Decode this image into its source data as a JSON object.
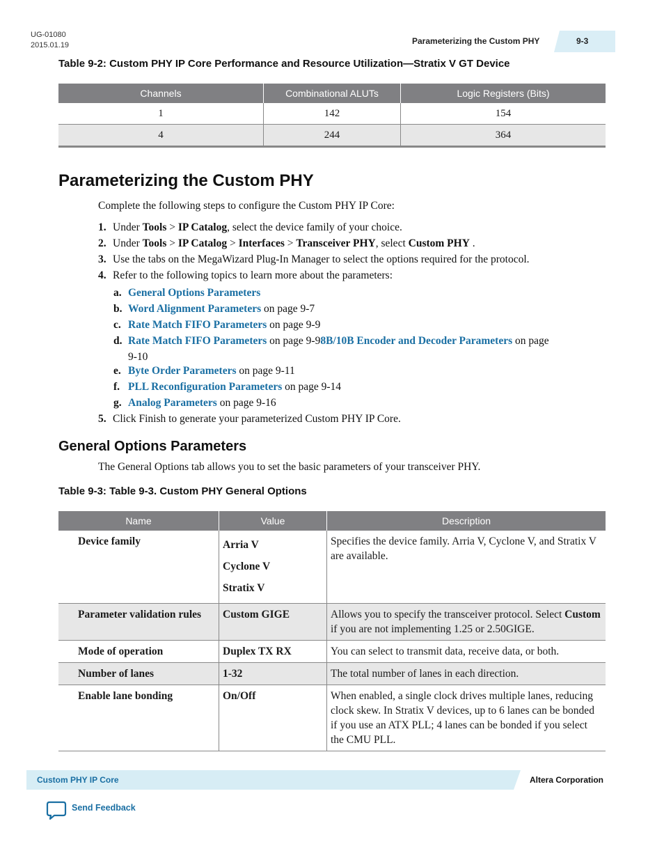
{
  "header": {
    "doc_id": "UG-01080",
    "doc_date": "2015.01.19",
    "section_title": "Parameterizing the Custom PHY",
    "page_number": "9-3"
  },
  "table_9_2": {
    "caption": "Table 9-2: Custom PHY IP Core Performance and Resource Utilization—Stratix V GT Device",
    "columns": [
      "Channels",
      "Combinational ALUTs",
      "Logic Registers (Bits)"
    ],
    "rows": [
      [
        "1",
        "142",
        "154"
      ],
      [
        "4",
        "244",
        "364"
      ]
    ]
  },
  "section": {
    "title": "Parameterizing the Custom PHY",
    "intro": "Complete the following steps to configure the Custom PHY IP Core:",
    "steps": [
      {
        "num": "1.",
        "parts": [
          "Under ",
          "Tools",
          " > ",
          "IP Catalog",
          ", select the device family of your choice."
        ]
      },
      {
        "num": "2.",
        "parts": [
          "Under ",
          "Tools",
          " > ",
          "IP Catalog",
          " > ",
          "Interfaces",
          " > ",
          "Transceiver PHY",
          ", select ",
          "Custom PHY",
          " ."
        ]
      },
      {
        "num": "3.",
        "text": "Use the tabs on the MegaWizard Plug-In Manager to select the options required for the protocol."
      },
      {
        "num": "4.",
        "text": "Refer to the following topics to learn more about the parameters:"
      },
      {
        "num": "5.",
        "text": "Click Finish to generate your parameterized Custom PHY IP Core."
      }
    ],
    "topics": [
      {
        "num": "a.",
        "link": "General Options Parameters",
        "suffix": ""
      },
      {
        "num": "b.",
        "link": "Word Alignment Parameters",
        "suffix": " on page 9-7"
      },
      {
        "num": "c.",
        "link": "Rate Match FIFO Parameters",
        "suffix": " on page 9-9"
      },
      {
        "num": "d.",
        "link": "Rate Match FIFO Parameters",
        "mid": " on page 9-9",
        "link2": "8B/10B Encoder and Decoder Parameters",
        "suffix": " on page",
        "suffix2": "9-10"
      },
      {
        "num": "e.",
        "link": "Byte Order Parameters",
        "suffix": " on page 9-11"
      },
      {
        "num": "f.",
        "link": "PLL Reconfiguration Parameters",
        "suffix": " on page 9-14"
      },
      {
        "num": "g.",
        "link": "Analog Parameters",
        "suffix": " on page 9-16"
      }
    ]
  },
  "subsection": {
    "title": "General Options Parameters",
    "intro": "The General Options tab allows you to set the basic parameters of your transceiver PHY."
  },
  "table_9_3": {
    "caption": "Table 9-3: Table 9-3.   Custom PHY General Options",
    "columns": [
      "Name",
      "Value",
      "Description"
    ],
    "rows": [
      {
        "name": "Device family",
        "values": [
          "Arria V",
          "Cyclone V",
          "Stratix V"
        ],
        "description": "Specifies the device family. Arria V, Cyclone V, and Stratix V are available."
      },
      {
        "name": "Parameter validation rules",
        "values": [
          "Custom GIGE"
        ],
        "description_parts": [
          "Allows you to specify the transceiver protocol. Select ",
          "Custom",
          " if you are not implementing 1.25 or 2.50GIGE."
        ]
      },
      {
        "name": "Mode of operation",
        "values": [
          "Duplex TX RX"
        ],
        "description": "You can select to transmit data, receive data, or both."
      },
      {
        "name": "Number of lanes",
        "values": [
          "1-32"
        ],
        "description": "The total number of lanes in each direction."
      },
      {
        "name": "Enable lane bonding",
        "values": [
          "On/Off"
        ],
        "description": "When enabled, a single clock drives multiple lanes, reducing clock skew. In Stratix V devices, up to 6 lanes can be bonded if you use an ATX PLL; 4 lanes can be bonded if you select the CMU PLL."
      }
    ]
  },
  "footer": {
    "product": "Custom PHY IP Core",
    "company": "Altera Corporation",
    "feedback_label": "Send Feedback",
    "feedback_icon": "speech-bubble-icon"
  },
  "colors": {
    "link": "#1a6fa3",
    "table_header": "#808083",
    "band_accent": "#d7edf5",
    "alt_row": "#e7e7e7"
  }
}
